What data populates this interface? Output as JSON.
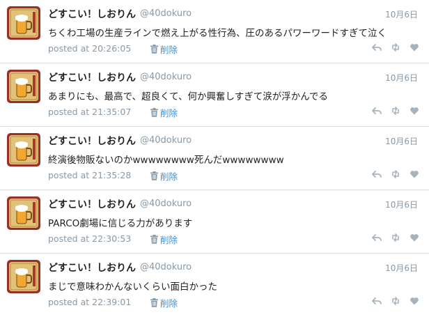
{
  "tweets": [
    {
      "name": "どすこい！しおりん",
      "handle": "@40dokuro",
      "date": "10月6日",
      "text": "ちくわ工場の生産ラインで燃え上がる性行為、圧のあるパワーワードすぎて泣く",
      "posted": "posted at 20:26:05",
      "delete_label": "削除"
    },
    {
      "name": "どすこい！しおりん",
      "handle": "@40dokuro",
      "date": "10月6日",
      "text": "あまりにも、最高で、超良くて、何か興奮しすぎて涙が浮かんでる",
      "posted": "posted at 21:35:07",
      "delete_label": "削除"
    },
    {
      "name": "どすこい！しおりん",
      "handle": "@40dokuro",
      "date": "10月6日",
      "text": "終演後物販ないのかwwwwwwww死んだwwwwwwww",
      "posted": "posted at 21:35:28",
      "delete_label": "削除"
    },
    {
      "name": "どすこい！しおりん",
      "handle": "@40dokuro",
      "date": "10月6日",
      "text": "PARCO劇場に信じる力があります",
      "posted": "posted at 22:30:53",
      "delete_label": "削除"
    },
    {
      "name": "どすこい！しおりん",
      "handle": "@40dokuro",
      "date": "10月6日",
      "text": "まじで意味わかんないくらい面白かった",
      "posted": "posted at 22:39:01",
      "delete_label": "削除"
    }
  ],
  "colors": {
    "link": "#3b8fd4",
    "muted": "#8899a6",
    "avatar_bg": "#9a2f2a"
  },
  "icons": {
    "delete": "trash-icon",
    "reply": "reply-icon",
    "retweet": "retweet-icon",
    "like": "heart-icon"
  }
}
